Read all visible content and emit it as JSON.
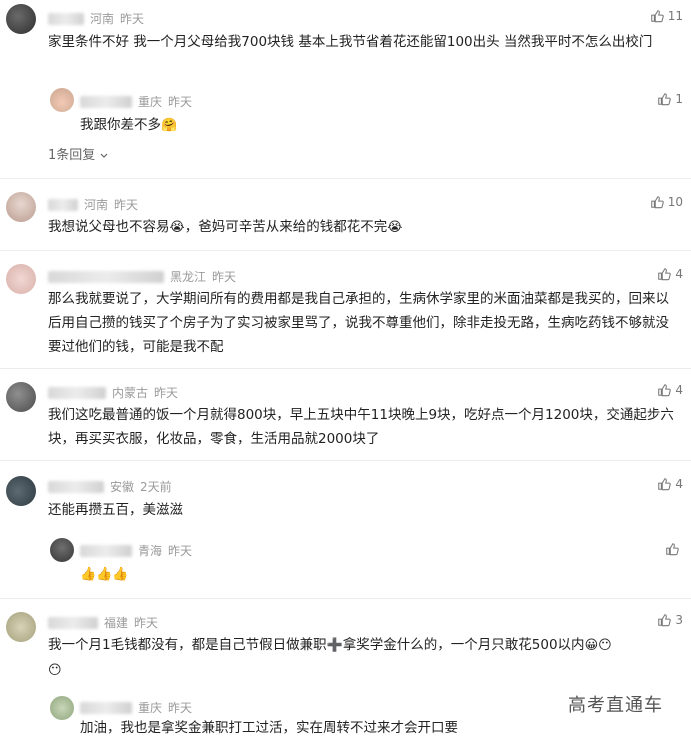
{
  "comments": [
    {
      "location": "河南",
      "time": "昨天",
      "likes": "11",
      "text": "家里条件不好 我一个月父母给我700块钱 基本上我节省着花还能留100出头 当然我平时不怎么出校门",
      "reply": {
        "location": "重庆",
        "time": "昨天",
        "likes": "1",
        "text": "我跟你差不多",
        "emoji": "🤗"
      },
      "replies_toggle": "1条回复"
    },
    {
      "location": "河南",
      "time": "昨天",
      "likes": "10",
      "text": "我想说父母也不容易",
      "emoji1": "😭",
      "text2": "，爸妈可辛苦从来给的钱都花不完",
      "emoji2": "😭"
    },
    {
      "location": "黑龙江",
      "time": "昨天",
      "likes": "4",
      "text": "那么我就要说了，大学期间所有的费用都是我自己承担的，生病休学家里的米面油菜都是我买的，回来以后用自己攒的钱买了个房子为了实习被家里骂了，说我不尊重他们，除非走投无路，生病吃药钱不够就没要过他们的钱，可能是我不配"
    },
    {
      "location": "内蒙古",
      "time": "昨天",
      "likes": "4",
      "text": "我们这吃最普通的饭一个月就得800块，早上五块中午11块晚上9块，吃好点一个月1200块，交通起步六块，再买买衣服，化妆品，零食，生活用品就2000块了"
    },
    {
      "location": "安徽",
      "time": "2天前",
      "likes": "4",
      "text": "还能再攒五百，美滋滋",
      "reply": {
        "location": "青海",
        "time": "昨天",
        "likes": "",
        "text": "",
        "emoji": "👍👍👍"
      }
    },
    {
      "location": "福建",
      "time": "昨天",
      "likes": "3",
      "text": "我一个月1毛钱都没有，都是自己节假日做兼职",
      "plus": "➕",
      "text2": "拿奖学金什么的，一个月只敢花500以内",
      "emoji": "😀😶",
      "emoji_line2": "😶",
      "reply": {
        "location": "重庆",
        "time": "昨天",
        "likes": "",
        "text": "加油，我也是拿奖金兼职打工过活，实在周转不过来才会开口要"
      }
    }
  ],
  "watermark": "高考直通车"
}
